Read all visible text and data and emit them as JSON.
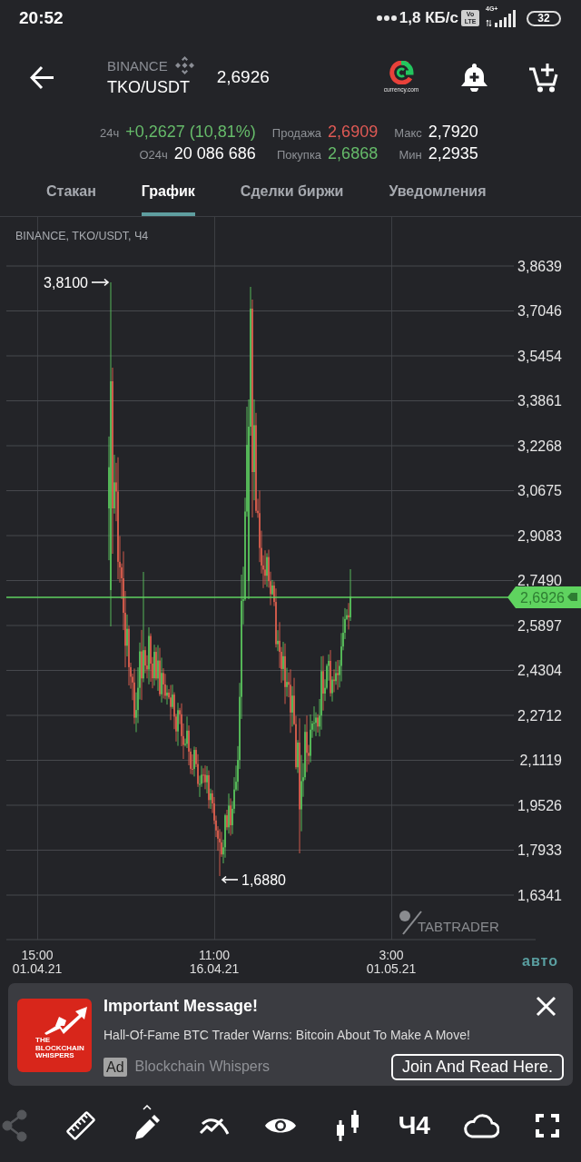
{
  "status_bar": {
    "time": "20:52",
    "network_speed": "1,8 КБ/с",
    "volte": "Vo LTE",
    "network_type": "4G+",
    "battery": "32"
  },
  "header": {
    "exchange": "BINANCE",
    "pair": "TKO/USDT",
    "price": "2,6926",
    "partner_caption": "currency.com"
  },
  "stats": [
    {
      "rows": [
        {
          "label": "24ч",
          "value": "+0,2627 (10,81%)",
          "kind": "up"
        },
        {
          "label": "О24ч",
          "value": "20 086 686",
          "kind": "plain"
        }
      ]
    },
    {
      "rows": [
        {
          "label": "Продажа",
          "value": "2,6909",
          "kind": "down"
        },
        {
          "label": "Покупка",
          "value": "2,6868",
          "kind": "up"
        }
      ]
    },
    {
      "rows": [
        {
          "label": "Макс",
          "value": "2,7920",
          "kind": "plain"
        },
        {
          "label": "Мин",
          "value": "2,2935",
          "kind": "plain"
        }
      ]
    }
  ],
  "tabs": [
    {
      "label": "Стакан",
      "selected": false
    },
    {
      "label": "График",
      "selected": true
    },
    {
      "label": "Сделки биржи",
      "selected": false
    },
    {
      "label": "Уведомления",
      "selected": false
    }
  ],
  "chart": {
    "title": "BINANCE, TKO/USDT, Ч4",
    "y_labels": [
      "3,8639",
      "3,7046",
      "3,5454",
      "3,3861",
      "3,2268",
      "3,0675",
      "2,9083",
      "2,7490",
      "2,5897",
      "2,4304",
      "2,2712",
      "2,1119",
      "1,9526",
      "1,7933",
      "1,6341"
    ],
    "x_labels": [
      {
        "time": "15:00",
        "date": "01.04.21"
      },
      {
        "time": "11:00",
        "date": "16.04.21"
      },
      {
        "time": "3:00",
        "date": "01.05.21"
      }
    ],
    "high_marker": "3,8100",
    "low_marker": "1,6880",
    "last_price": "2,6926",
    "watermark": "TABTRADER",
    "scale_mode": "авто"
  },
  "ad": {
    "logo_text": "THE BLOCKCHAIN WHISPERS",
    "title": "Important Message!",
    "text": "Hall-Of-Fame BTC Trader Warns: Bitcoin About To Make A Move!",
    "badge": "Ad",
    "advertiser": "Blockchain Whispers",
    "button": "Join And Read Here."
  },
  "toolbar": {
    "share_disabled": true,
    "timeframe": "Ч4"
  }
}
